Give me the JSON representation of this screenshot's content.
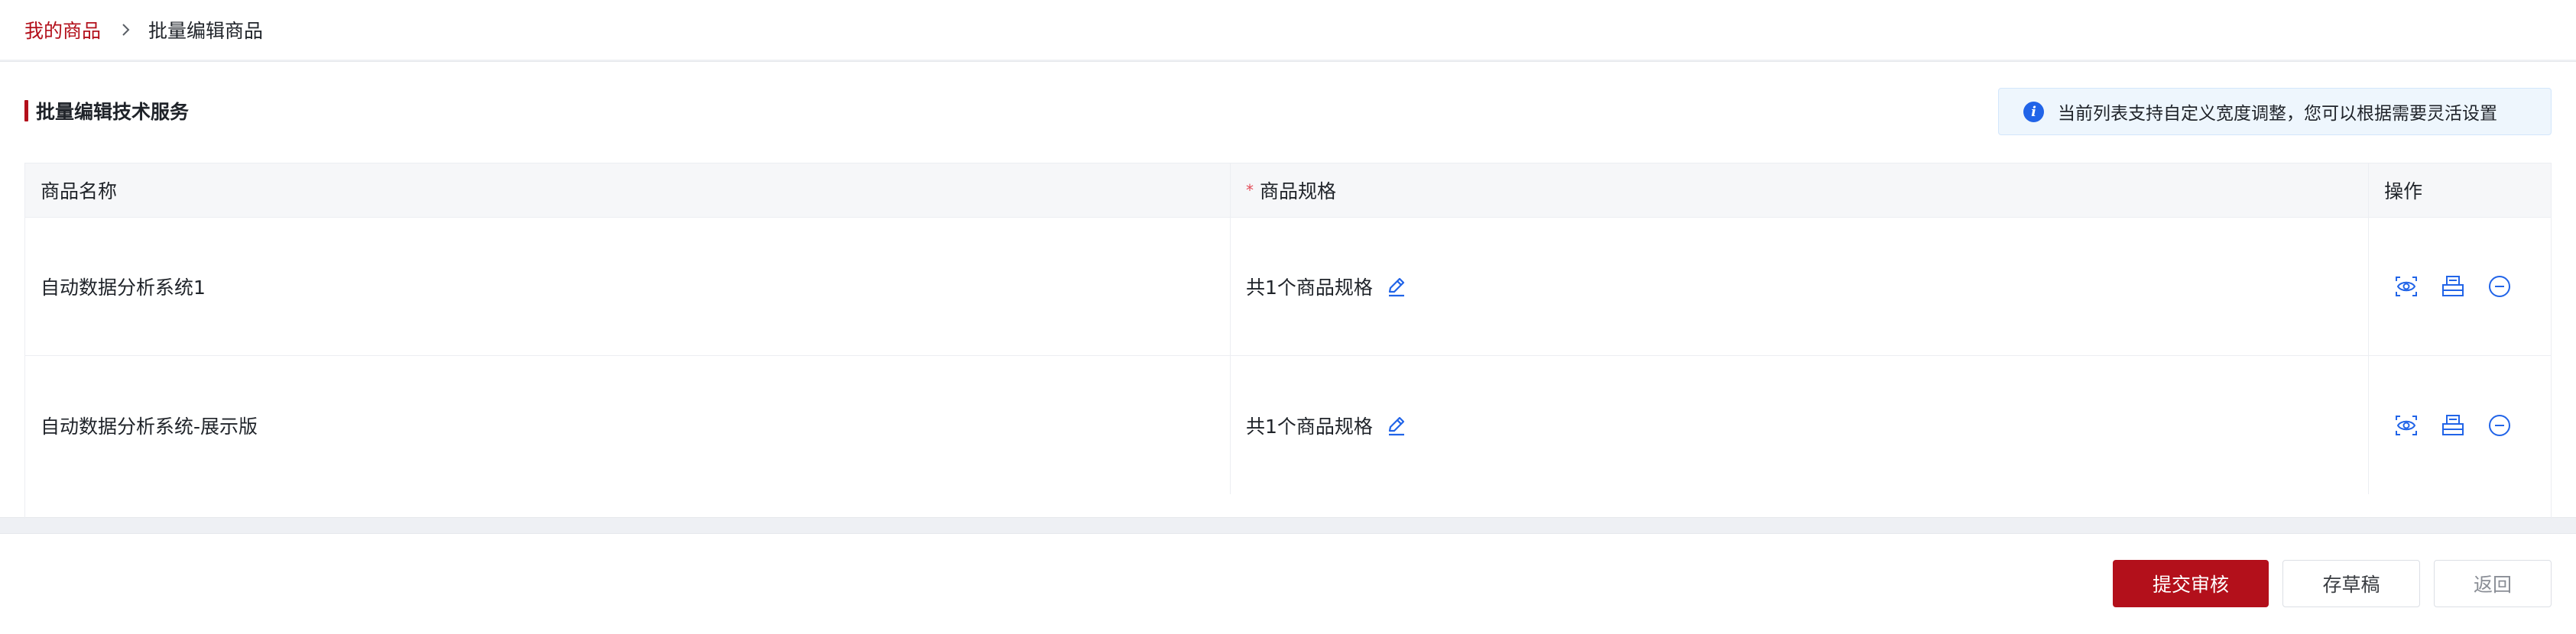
{
  "breadcrumb": {
    "parent": "我的商品",
    "current": "批量编辑商品"
  },
  "section": {
    "title": "批量编辑技术服务"
  },
  "tip": {
    "text": "当前列表支持自定义宽度调整，您可以根据需要灵活设置"
  },
  "table": {
    "headers": {
      "name": "商品名称",
      "required_mark": "*",
      "spec": "商品规格",
      "ops": "操作"
    },
    "rows": [
      {
        "name": "自动数据分析系统1",
        "spec": "共1个商品规格"
      },
      {
        "name": "自动数据分析系统-展示版",
        "spec": "共1个商品规格"
      }
    ]
  },
  "footer": {
    "submit_label": "提交审核",
    "draft_label": "存草稿",
    "back_label": "返回"
  },
  "colors": {
    "brand": "#b3101b",
    "icon_blue": "#2164e8"
  }
}
